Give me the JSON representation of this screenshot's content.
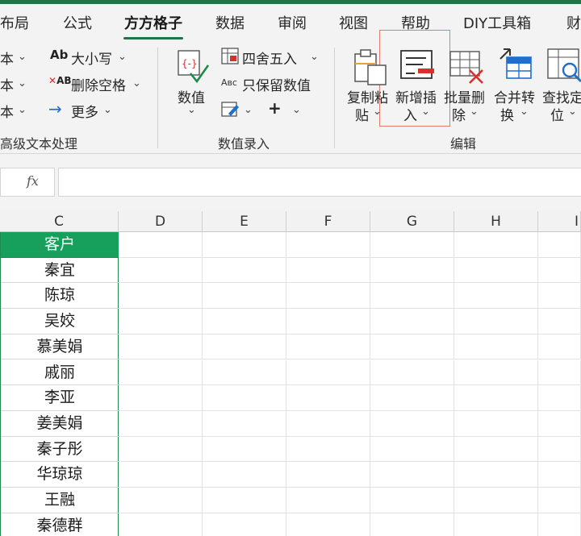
{
  "tabs": [
    {
      "label": "布局",
      "active": false
    },
    {
      "label": "公式",
      "active": false
    },
    {
      "label": "方方格子",
      "active": true
    },
    {
      "label": "数据",
      "active": false
    },
    {
      "label": "审阅",
      "active": false
    },
    {
      "label": "视图",
      "active": false
    },
    {
      "label": "帮助",
      "active": false
    },
    {
      "label": "DIY工具箱",
      "active": false
    },
    {
      "label": "财",
      "active": false
    }
  ],
  "ribbon": {
    "text_group": {
      "left_items": [
        "本",
        "本",
        "本"
      ],
      "case_label": "大小写",
      "delete_space_label": "删除空格",
      "more_label": "更多",
      "group_label": "高级文本处理"
    },
    "numeric_group": {
      "value_label": "数值",
      "round_label": "四舍五入",
      "keep_value_label": "只保留数值",
      "plus_label": "+",
      "group_label": "数值录入"
    },
    "edit_group": {
      "copy_paste_label_1": "复制粘",
      "copy_paste_label_2": "贴",
      "insert_label_1": "新增插",
      "insert_label_2": "入",
      "batch_delete_label_1": "批量删",
      "batch_delete_label_2": "除",
      "merge_label_1": "合并转",
      "merge_label_2": "换",
      "find_label_1": "查找定",
      "find_label_2": "位",
      "group_label": "编辑"
    }
  },
  "formula_bar": {
    "fx_label": "fx",
    "value": ""
  },
  "sheet": {
    "columns": [
      "C",
      "D",
      "E",
      "F",
      "G",
      "H",
      "I"
    ],
    "c_header": "客户",
    "c_values": [
      "秦宜",
      "陈琼",
      "吴姣",
      "慕美娟",
      "戚丽",
      "李亚",
      "姜美娟",
      "秦子彤",
      "华琼琼",
      "王融",
      "秦德群"
    ]
  },
  "colors": {
    "accent": "#217346",
    "header_fill": "#17a05b",
    "highlight_border": "#e47a72"
  }
}
